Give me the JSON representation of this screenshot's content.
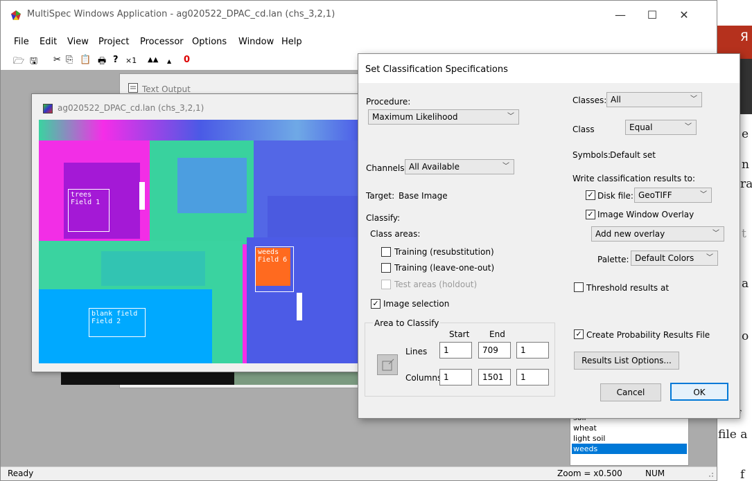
{
  "app": {
    "title": "MultiSpec Windows Application - ag020522_DPAC_cd.lan (chs_3,2,1)",
    "minimize": "—",
    "maximize": "☐",
    "close": "✕",
    "menu": [
      "File",
      "Edit",
      "View",
      "Project",
      "Processor",
      "Options",
      "Window",
      "Help"
    ],
    "toolbar": [
      "🗁",
      "🖫",
      "✂",
      "⎘",
      "📋",
      "🖶",
      "?",
      "×1",
      "▲▲",
      "▲",
      "0"
    ]
  },
  "text_output_window": {
    "title": "Text Output"
  },
  "image_window": {
    "title": "ag020522_DPAC_cd.lan (chs_3,2,1)",
    "fields": [
      {
        "name": "trees",
        "label": "Field 1"
      },
      {
        "name": "weeds",
        "label": "Field 6"
      },
      {
        "name": "blank field",
        "label": "Field 2"
      }
    ]
  },
  "class_list": [
    "soil",
    "wheat",
    "light soil",
    "weeds"
  ],
  "class_list_selected": "weeds",
  "status": {
    "text": "Ready",
    "zoom": "Zoom  = x0.500",
    "num": "NUM"
  },
  "right_text": {
    "r1": "Я",
    "r2": "e",
    "r3": "n",
    "r4": "ra",
    "r5": "t",
    "r6": "a",
    "r7": "o",
    "r8": "he f",
    "r9": "file a",
    "r10": "f"
  },
  "dialog": {
    "title": "Set Classification Specifications",
    "procedure_label": "Procedure:",
    "procedure_value": "Maximum Likelihood",
    "channels_label": "Channels:",
    "channels_value": "All Available",
    "target_label": "Target:",
    "target_value": "Base Image",
    "classify_label": "Classify:",
    "class_areas_label": "Class areas:",
    "training_resub": "Training (resubstitution)",
    "training_loo": "Training (leave-one-out)",
    "test_areas": "Test areas (holdout)",
    "image_selection": "Image selection",
    "area_group": "Area to Classify",
    "start_label": "Start",
    "end_label": "End",
    "lines_label": "Lines",
    "columns_label": "Columns",
    "lines_start": "1",
    "lines_end": "709",
    "lines_interval": "1",
    "columns_start": "1",
    "columns_end": "1501",
    "columns_interval": "1",
    "classes_label": "Classes:",
    "classes_value": "All",
    "class_label": "Class",
    "class_weight": "Equal",
    "symbols_label": "Symbols:",
    "symbols_value": "Default set",
    "write_label": "Write classification results to:",
    "disk_file_label": "Disk file:",
    "disk_file_value": "GeoTIFF",
    "image_overlay_label": "Image Window Overlay",
    "overlay_value": "Add new overlay",
    "palette_label": "Palette:",
    "palette_value": "Default Colors",
    "threshold_label": "Threshold results at",
    "prob_label": "Create Probability Results File",
    "results_list_btn": "Results List Options...",
    "cancel_btn": "Cancel",
    "ok_btn": "OK",
    "check": "✓"
  }
}
